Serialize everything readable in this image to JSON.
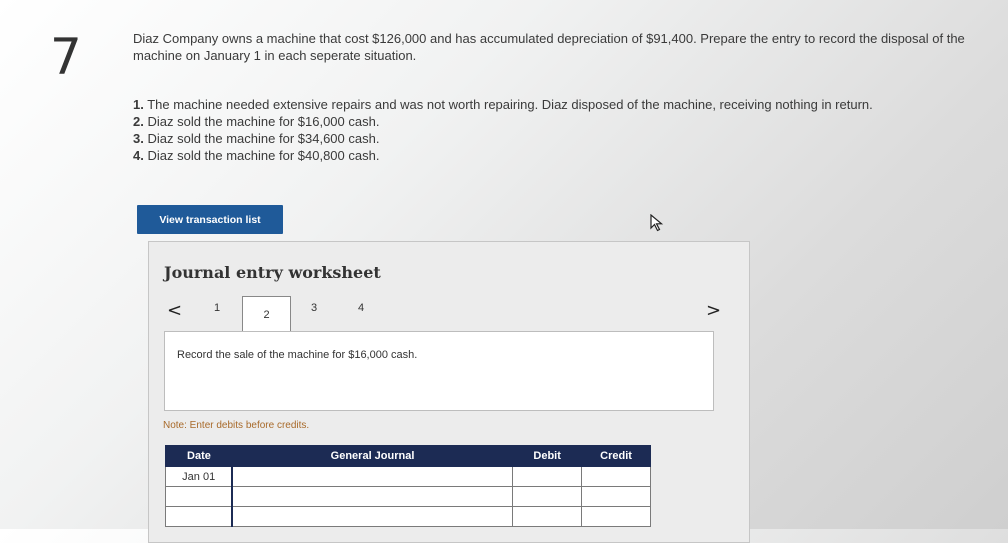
{
  "question": {
    "number": "7",
    "text": "Diaz Company owns a machine that cost $126,000 and has accumulated depreciation of $91,400. Prepare the entry to record the disposal of the machine on January 1 in each seperate situation.",
    "scenarios": [
      {
        "num": "1.",
        "text": "The machine needed extensive repairs and was not worth repairing. Diaz disposed of the machine, receiving nothing in return."
      },
      {
        "num": "2.",
        "text": "Diaz sold the machine for $16,000 cash."
      },
      {
        "num": "3.",
        "text": "Diaz sold the machine for $34,600 cash."
      },
      {
        "num": "4.",
        "text": "Diaz sold the machine for $40,800 cash."
      }
    ]
  },
  "buttons": {
    "view_transaction_list": "View transaction list"
  },
  "worksheet": {
    "title": "Journal entry worksheet",
    "prev_arrow": "<",
    "next_arrow": ">",
    "pages": [
      "1",
      "2",
      "3",
      "4"
    ],
    "active_page": "2",
    "description": "Record the sale of the machine for $16,000 cash.",
    "note": "Note: Enter debits before credits."
  },
  "table": {
    "headers": [
      "Date",
      "General Journal",
      "Debit",
      "Credit"
    ],
    "rows": [
      {
        "date": "Jan 01",
        "account": "",
        "debit": "",
        "credit": ""
      },
      {
        "date": "",
        "account": "",
        "debit": "",
        "credit": ""
      },
      {
        "date": "",
        "account": "",
        "debit": "",
        "credit": ""
      }
    ]
  },
  "colors": {
    "button_bg": "#1f5a99",
    "table_header_bg": "#1c2b54",
    "note_color": "#a86a2a"
  }
}
